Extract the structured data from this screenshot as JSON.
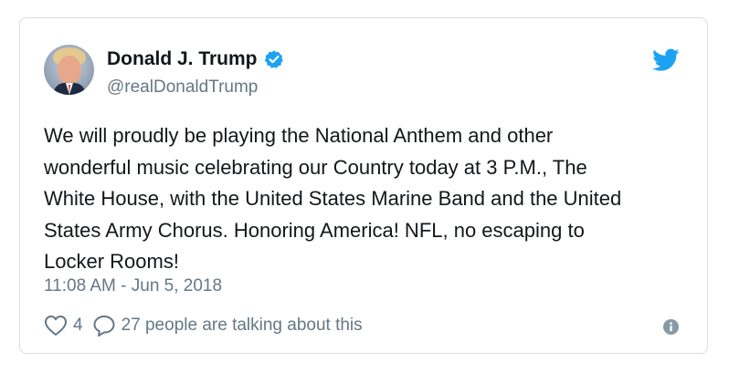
{
  "tweet": {
    "author_name": "Donald J. Trump",
    "handle": "@realDonaldTrump",
    "text": "We will proudly be playing the National Anthem and other\nwonderful music celebrating our Country today at 3 P.M., The\nWhite House, with the United States Marine Band and the United\nStates Army Chorus. Honoring America! NFL, no escaping to\nLocker Rooms!",
    "timestamp": "11:08 AM - Jun 5, 2018",
    "like_count": "4",
    "reply_text": "27 people are talking about this"
  },
  "icons": {
    "verified": "verified-badge-icon",
    "brand": "twitter-bird-icon",
    "like": "heart-icon",
    "reply": "reply-bubble-icon",
    "info": "info-icon"
  },
  "colors": {
    "brand_blue": "#1da1f2",
    "text_primary": "#14171a",
    "text_secondary": "#657786",
    "border": "#d9dde1"
  }
}
